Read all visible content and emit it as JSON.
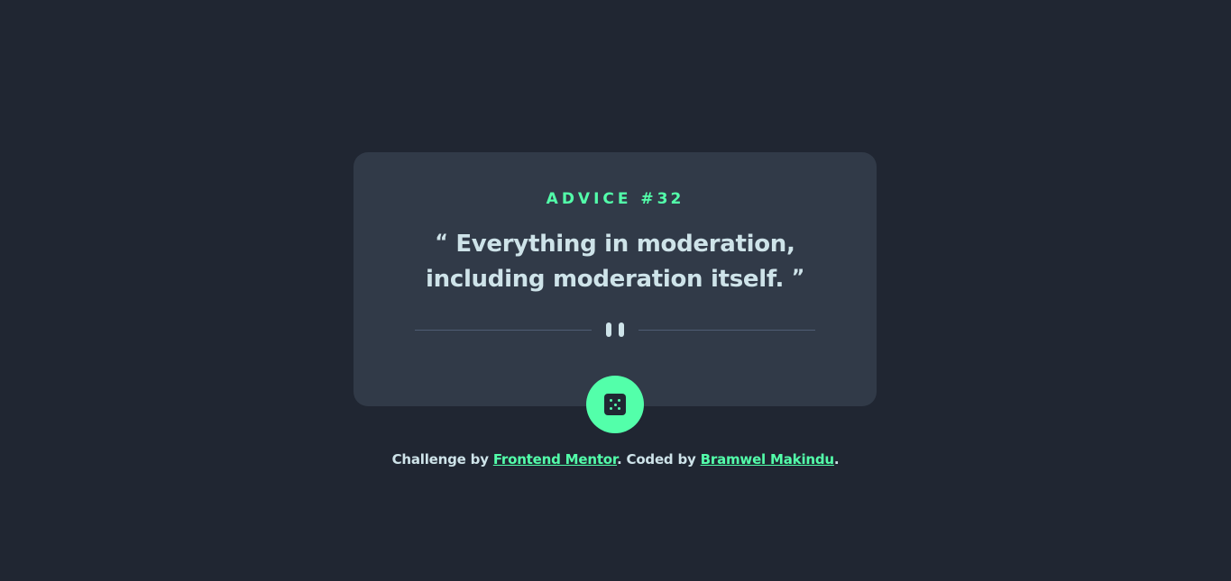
{
  "card": {
    "advice_label": "ADVICE #",
    "advice_number": "32",
    "open_quote": "“",
    "quote_text": "Everything in moderation, including moderation itself.",
    "close_quote": "”"
  },
  "button": {
    "icon": "dice-icon"
  },
  "footer": {
    "prefix": "Challenge by ",
    "link1": "Frontend Mentor",
    "middle": ". Coded by ",
    "link2": "Bramwel Makindu",
    "suffix": "."
  },
  "colors": {
    "background": "#202632",
    "card": "#313A48",
    "accent": "#53FFAA",
    "text": "#CEE3E9",
    "divider": "#4F5D74"
  }
}
